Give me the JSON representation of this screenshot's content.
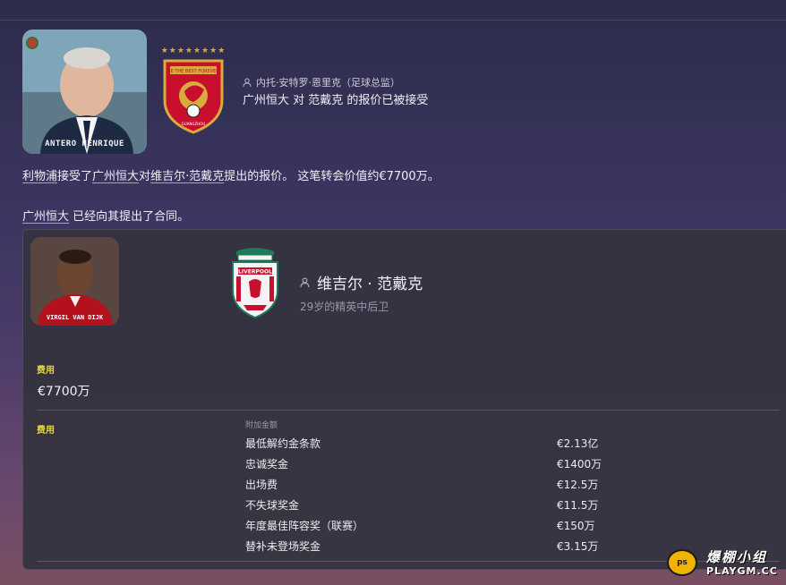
{
  "header": {
    "photo_name": "ANTERO HENRIQUE",
    "sender": "内托·安特罗·恩里克（足球总监）",
    "title": "广州恒大 对 范戴克 的报价已被接受",
    "club_badge_text": "BE THE BEST FOREVER",
    "club_badge_sub": "GUANGZHOU",
    "stars": "★★★★★★★★"
  },
  "body": {
    "line1_club_a": "利物浦",
    "line1_mid": "接受了",
    "line1_club_b": "广州恒大",
    "line1_to": "对",
    "line1_player": "维吉尔·范戴克",
    "line1_tail": "提出的报价。 这笔转会价值约€7700万。",
    "line2_club": "广州恒大",
    "line2_tail": " 已经向其提出了合同。"
  },
  "player": {
    "photo_name": "VIRGIL VAN DIJK",
    "name": "维吉尔 · 范戴克",
    "description": "29岁的精英中后卫",
    "badge_text": "LIVERPOOL"
  },
  "fees": {
    "fee_label": "费用",
    "fee_value": "€7700万",
    "fee_label2": "费用",
    "extra_header": "附加金额",
    "extras": [
      {
        "label": "最低解约金条款",
        "value": "€2.13亿"
      },
      {
        "label": "忠诚奖金",
        "value": "€1400万"
      },
      {
        "label": "出场费",
        "value": "€12.5万"
      },
      {
        "label": "不失球奖金",
        "value": "€11.5万"
      },
      {
        "label": "年度最佳阵容奖（联赛）",
        "value": "€150万"
      },
      {
        "label": "替补未登场奖金",
        "value": "€3.15万"
      }
    ]
  },
  "watermark": {
    "logo": "ps",
    "cn": "爆棚小组",
    "en": "PLAYGM.CC"
  },
  "colors": {
    "accent_yellow": "#e6d93c",
    "gz_red": "#c8102e",
    "gz_gold": "#d8ab3a",
    "lfc_red": "#c8102e",
    "lfc_green": "#1f7a5a"
  }
}
